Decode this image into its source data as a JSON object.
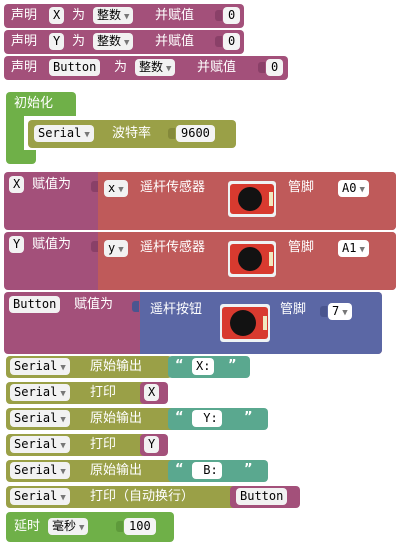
{
  "declarations": [
    {
      "kw": "声明",
      "name": "X",
      "as": "为",
      "type": "整数",
      "assign": "并赋值",
      "value": "0"
    },
    {
      "kw": "声明",
      "name": "Y",
      "as": "为",
      "type": "整数",
      "assign": "并赋值",
      "value": "0"
    },
    {
      "kw": "声明",
      "name": "Button",
      "as": "为",
      "type": "整数",
      "assign": "并赋值",
      "value": "0"
    }
  ],
  "setup": {
    "title": "初始化",
    "serial_port": "Serial",
    "baud_label": "波特率",
    "baud_value": "9600"
  },
  "assignments": [
    {
      "var": "X",
      "assign_label": "赋值为",
      "axis": "x",
      "sensor_label": "遥杆传感器",
      "pin_label": "管脚",
      "pin": "A0"
    },
    {
      "var": "Y",
      "assign_label": "赋值为",
      "axis": "y",
      "sensor_label": "遥杆传感器",
      "pin_label": "管脚",
      "pin": "A1"
    },
    {
      "var": "Button",
      "assign_label": "赋值为",
      "sensor_label": "遥杆按钮",
      "pin_label": "管脚",
      "pin": "7"
    }
  ],
  "prints": [
    {
      "port": "Serial",
      "action": "原始输出",
      "text": "X:"
    },
    {
      "port": "Serial",
      "action": "打印",
      "var": "X"
    },
    {
      "port": "Serial",
      "action": "原始输出",
      "text": " Y:"
    },
    {
      "port": "Serial",
      "action": "打印",
      "var": "Y"
    },
    {
      "port": "Serial",
      "action": "原始输出",
      "text": " B:"
    },
    {
      "port": "Serial",
      "action": "打印（自动换行）",
      "var": "Button"
    }
  ],
  "delay": {
    "label": "延时",
    "unit": "毫秒",
    "value": "100"
  },
  "quote_open": "“",
  "quote_close": "”",
  "colors": {
    "variable": "#a3507a",
    "serial": "#9aa047",
    "sensor": "#bf5a5a",
    "button": "#5b67a5",
    "text": "#5aa88f",
    "control": "#6fb048"
  },
  "icons": {
    "dropdown": "triangle-down",
    "sensor_image": "joystick-module"
  }
}
